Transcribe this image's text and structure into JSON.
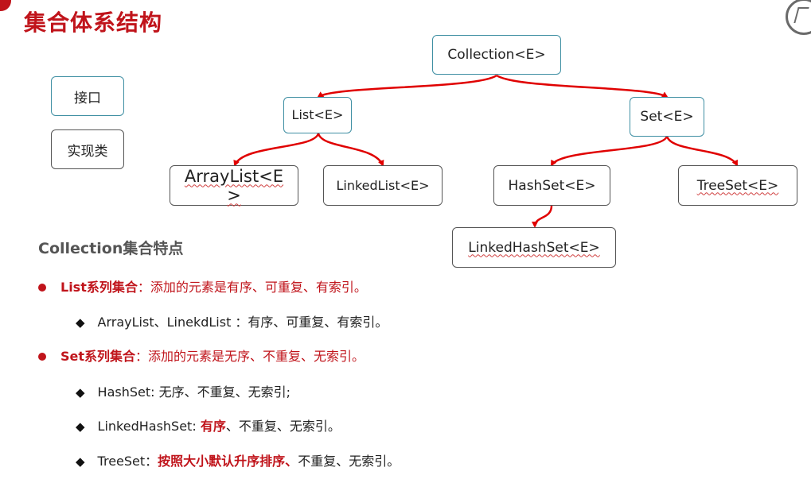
{
  "page": {
    "title": "集合体系结构"
  },
  "legend": {
    "interface": "接口",
    "implementation": "实现类"
  },
  "diagram": {
    "collection": "Collection<E>",
    "list": "List<E>",
    "set": "Set<E>",
    "arraylist": "ArrayList<E>",
    "linkedlist": "LinkedList<E>",
    "hashset": "HashSet<E>",
    "treeset": "TreeSet<E>",
    "linkedhashset": "LinkedHashSet<E>",
    "arrow_color": "#e00000"
  },
  "features": {
    "title": "Collection集合特点",
    "list_head": "List系列集合",
    "list_desc": "：添加的元素是有序、可重复、有索引。",
    "list_sub": "ArrayList、LinekdList ：有序、可重复、有索引。",
    "set_head": "Set系列集合",
    "set_desc": "：添加的元素是无序、不重复、无索引。",
    "hashset_line": "HashSet: 无序、不重复、无索引;",
    "lhs_prefix": "LinkedHashSet: ",
    "lhs_highlight": "有序",
    "lhs_rest": "、不重复、无索引。",
    "treeset_prefix": "TreeSet：",
    "treeset_highlight": "按照大小默认升序排序、",
    "treeset_rest": "不重复、无索引。"
  },
  "colors": {
    "accent": "#c0141b",
    "interface_border": "#3f8fa3"
  }
}
